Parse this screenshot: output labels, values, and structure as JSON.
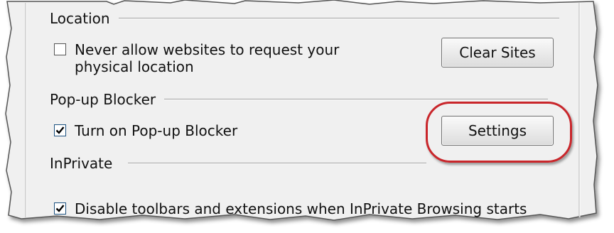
{
  "location": {
    "heading": "Location",
    "never_allow_label": "Never allow websites to request your physical location",
    "never_allow_checked": false,
    "clear_sites_label": "Clear Sites"
  },
  "popup": {
    "heading": "Pop-up Blocker",
    "turn_on_label": "Turn on Pop-up Blocker",
    "turn_on_checked": true,
    "settings_label": "Settings"
  },
  "inprivate": {
    "heading": "InPrivate",
    "disable_label": "Disable toolbars and extensions when InPrivate Browsing starts",
    "disable_checked": true
  },
  "colors": {
    "panel_bg": "#f0f0f0",
    "highlight_ring": "#c9262b",
    "checkbox_border": "#1c5180"
  }
}
